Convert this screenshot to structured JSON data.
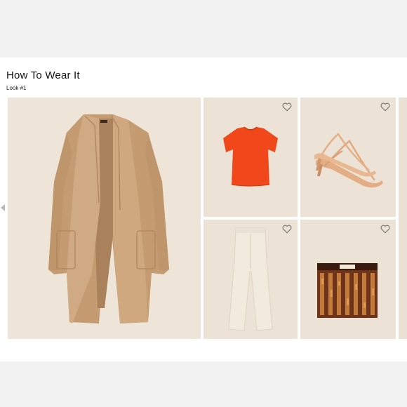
{
  "section": {
    "title": "How To Wear It",
    "subtitle": "Look #1"
  },
  "items": [
    {
      "name": "camel-coat",
      "favorited": false
    },
    {
      "name": "orange-tee",
      "favorited": false
    },
    {
      "name": "nude-heels",
      "favorited": false
    },
    {
      "name": "white-jeans",
      "favorited": false
    },
    {
      "name": "tortoise-clutch",
      "favorited": false
    }
  ],
  "colors": {
    "tile_background": "#ece3d6",
    "coat": "#c9a27a",
    "tee": "#f04a1c",
    "heels": "#e6b48c",
    "jeans": "#f2ede2",
    "clutch": "#7a3b1c"
  },
  "icons": {
    "favorite": "heart-outline-icon",
    "carousel_prev": "triangle-left-icon"
  }
}
